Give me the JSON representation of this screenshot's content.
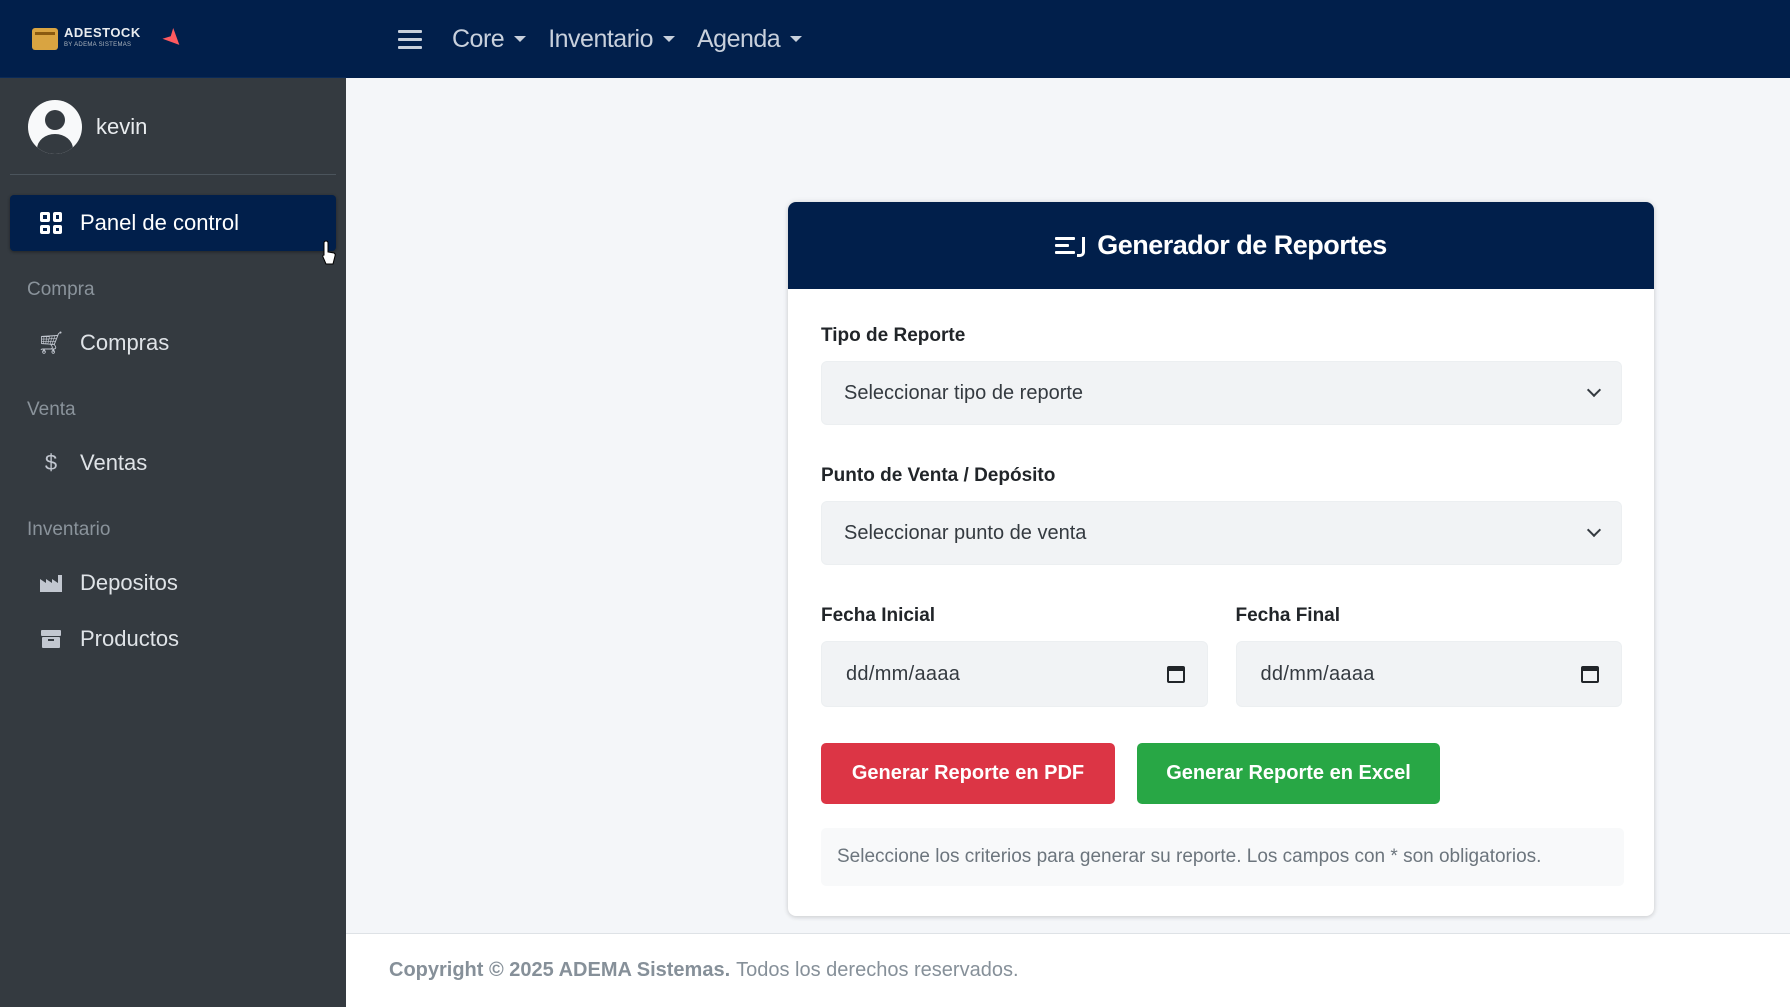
{
  "brand": {
    "name": "ADESTOCK",
    "tagline": "BY ADEMA SISTEMAS"
  },
  "user": {
    "name": "kevin"
  },
  "sidebar": {
    "active": {
      "label": "Panel de control",
      "icon": "dashboard-grid-icon"
    },
    "sections": [
      {
        "header": "Compra",
        "items": [
          {
            "label": "Compras",
            "icon": "cart-icon"
          }
        ]
      },
      {
        "header": "Venta",
        "items": [
          {
            "label": "Ventas",
            "icon": "dollar-icon"
          }
        ]
      },
      {
        "header": "Inventario",
        "items": [
          {
            "label": "Depositos",
            "icon": "warehouse-icon"
          },
          {
            "label": "Productos",
            "icon": "box-icon"
          }
        ]
      }
    ]
  },
  "topbar": {
    "menus": [
      {
        "label": "Core"
      },
      {
        "label": "Inventario"
      },
      {
        "label": "Agenda"
      }
    ]
  },
  "card": {
    "title": "Generador de Reportes",
    "tipo_label": "Tipo de Reporte",
    "tipo_value": "Seleccionar tipo de reporte",
    "punto_label": "Punto de Venta / Depósito",
    "punto_value": "Seleccionar punto de venta",
    "fecha_inicial_label": "Fecha Inicial",
    "fecha_inicial_placeholder": "dd/mm/aaaa",
    "fecha_final_label": "Fecha Final",
    "fecha_final_placeholder": "dd/mm/aaaa",
    "btn_pdf": "Generar Reporte en PDF",
    "btn_excel": "Generar Reporte en Excel",
    "help": "Seleccione los criterios para generar su reporte. Los campos con * son obligatorios."
  },
  "footer": {
    "copyright": "Copyright © 2025 ADEMA Sistemas.",
    "rights": "Todos los derechos reservados."
  },
  "colors": {
    "navy": "#011f4b",
    "sidebar": "#343a40",
    "pdf": "#dc3545",
    "excel": "#28a745"
  }
}
